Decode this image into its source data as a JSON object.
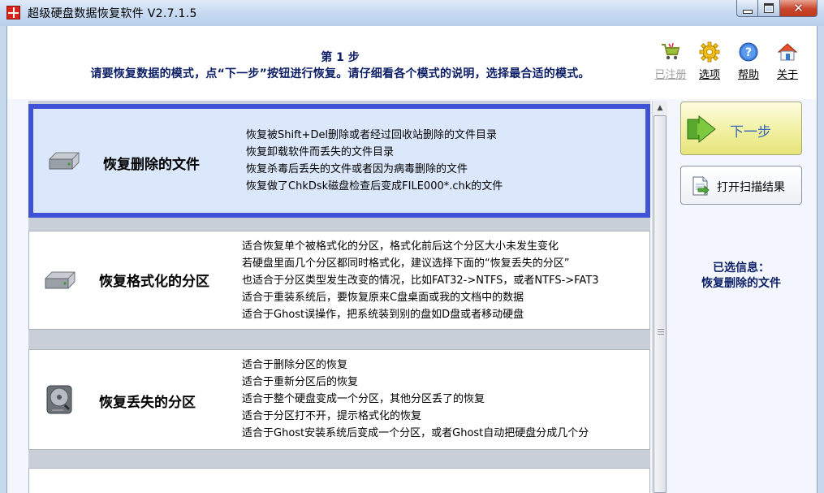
{
  "window": {
    "title": "超级硬盘数据恢复软件 V2.7.1.5",
    "controls": {
      "minimize": "minimize",
      "maximize": "maximize",
      "close": "close"
    }
  },
  "header": {
    "step_title": "第 1 步",
    "instruction": "请要恢复数据的模式，点“下一步”按钮进行恢复。请仔细看各个模式的说明，选择最合适的模式。"
  },
  "toolbar": [
    {
      "label": "已注册",
      "icon": "cart-icon",
      "enabled": false
    },
    {
      "label": "选项",
      "icon": "gear-icon",
      "enabled": true
    },
    {
      "label": "帮助",
      "icon": "help-icon",
      "enabled": true
    },
    {
      "label": "关于",
      "icon": "home-icon",
      "enabled": true
    }
  ],
  "modes": [
    {
      "name": "恢复删除的文件",
      "icon": "disk-drive-icon",
      "selected": true,
      "lines": [
        "恢复被Shift+Del删除或者经过回收站删除的文件目录",
        "恢复卸载软件而丢失的文件目录",
        "恢复杀毒后丢失的文件或者因为病毒删除的文件",
        "恢复做了ChkDsk磁盘检查后变成FILE000*.chk的文件"
      ]
    },
    {
      "name": "恢复格式化的分区",
      "icon": "disk-drive-icon",
      "selected": false,
      "lines": [
        "适合恢复单个被格式化的分区，格式化前后这个分区大小未发生变化",
        "若硬盘里面几个分区都同时格式化，建议选择下面的“恢复丢失的分区”",
        "也适合于分区类型发生改变的情况，比如FAT32->NTFS，或者NTFS->FAT3",
        "适合于重装系统后，要恢复原来C盘桌面或我的文档中的数据",
        "适合于Ghost误操作，把系统装到别的盘如D盘或者移动硬盘"
      ]
    },
    {
      "name": "恢复丢失的分区",
      "icon": "hard-disk-icon",
      "selected": false,
      "lines": [
        "适合于删除分区的恢复",
        "适合于重新分区后的恢复",
        "适合于整个硬盘变成一个分区，其他分区丢了的恢复",
        "适合于分区打不开，提示格式化的恢复",
        "适合于Ghost安装系统后变成一个分区，或者Ghost自动把硬盘分成几个分"
      ]
    }
  ],
  "actions": {
    "next": "下一步",
    "open_scan": "打开扫描结果"
  },
  "selection_info": {
    "label": "已选信息：",
    "value": "恢复删除的文件"
  },
  "colors": {
    "selected_border": "#3f51d6",
    "selected_bg": "#dbe8fb",
    "heading_text": "#0c1f66",
    "next_text": "#3b66b3"
  }
}
